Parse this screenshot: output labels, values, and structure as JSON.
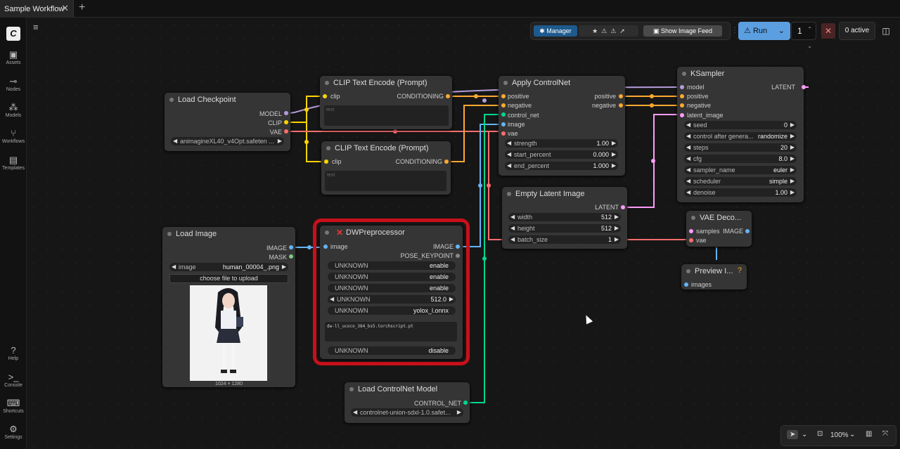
{
  "tab": {
    "title": "Sample Workflow",
    "close": "✕",
    "add": "+"
  },
  "sidebar": [
    {
      "icon": "assets-icon",
      "label": "Assets"
    },
    {
      "icon": "nodes-icon",
      "label": "Nodes"
    },
    {
      "icon": "models-icon",
      "label": "Models"
    },
    {
      "icon": "workflows-icon",
      "label": "Workflows"
    },
    {
      "icon": "templates-icon",
      "label": "Templates"
    },
    {
      "icon": "help-icon",
      "label": "Help"
    },
    {
      "icon": "console-icon",
      "label": "Console"
    },
    {
      "icon": "shortcuts-icon",
      "label": "Shortcuts"
    },
    {
      "icon": "settings-icon",
      "label": "Settings"
    }
  ],
  "toolbar": {
    "manager": "Manager",
    "image_feed": "Show Image Feed",
    "run": "Run",
    "count": "1",
    "active": "0 active"
  },
  "zoom": "100%",
  "nodes": {
    "load_checkpoint": {
      "title": "Load Checkpoint",
      "outputs": [
        "MODEL",
        "CLIP",
        "VAE"
      ],
      "ckpt": "animagineXL40_v4Opt.safeten ..."
    },
    "clip1": {
      "title": "CLIP Text Encode (Prompt)",
      "input": "clip",
      "output": "CONDITIONING",
      "placeholder": "text"
    },
    "clip2": {
      "title": "CLIP Text Encode (Prompt)",
      "input": "clip",
      "output": "CONDITIONING",
      "placeholder": "text"
    },
    "apply_cn": {
      "title": "Apply ControlNet",
      "inputs": [
        "positive",
        "negative",
        "control_net",
        "image",
        "vae"
      ],
      "outputs": [
        "positive",
        "negative"
      ],
      "widgets": [
        {
          "label": "strength",
          "value": "1.00"
        },
        {
          "label": "start_percent",
          "value": "0.000"
        },
        {
          "label": "end_percent",
          "value": "1.000"
        }
      ]
    },
    "ksampler": {
      "title": "KSampler",
      "inputs": [
        "model",
        "positive",
        "negative",
        "latent_image"
      ],
      "output": "LATENT",
      "widgets": [
        {
          "label": "seed",
          "value": "0"
        },
        {
          "label": "control after genera...",
          "value": "randomize"
        },
        {
          "label": "steps",
          "value": "20"
        },
        {
          "label": "cfg",
          "value": "8.0"
        },
        {
          "label": "sampler_name",
          "value": "euler"
        },
        {
          "label": "scheduler",
          "value": "simple"
        },
        {
          "label": "denoise",
          "value": "1.00"
        }
      ]
    },
    "empty_latent": {
      "title": "Empty Latent Image",
      "output": "LATENT",
      "widgets": [
        {
          "label": "width",
          "value": "512"
        },
        {
          "label": "height",
          "value": "512"
        },
        {
          "label": "batch_size",
          "value": "1"
        }
      ]
    },
    "vae_decode": {
      "title": "VAE Deco...",
      "inputs": [
        "samples",
        "vae"
      ],
      "output": "IMAGE"
    },
    "preview": {
      "title": "Preview I...",
      "input": "images",
      "badge": "?"
    },
    "load_image": {
      "title": "Load Image",
      "outputs": [
        "IMAGE",
        "MASK"
      ],
      "image_label": "image",
      "image_value": "human_00004_.png",
      "upload": "choose file to upload",
      "size": "1024 × 1280"
    },
    "dw": {
      "title": "DWPreprocessor",
      "error_mark": "✕",
      "input": "image",
      "outputs": [
        "IMAGE",
        "POSE_KEYPOINT"
      ],
      "widgets": [
        {
          "label": "UNKNOWN",
          "value": "enable"
        },
        {
          "label": "UNKNOWN",
          "value": "enable"
        },
        {
          "label": "UNKNOWN",
          "value": "enable"
        },
        {
          "label": "UNKNOWN",
          "value": "512.0"
        },
        {
          "label": "UNKNOWN",
          "value": "yolox_l.onnx"
        }
      ],
      "text": "dw-ll_ucoco_384_bs5.torchscript.pt",
      "last": {
        "label": "UNKNOWN",
        "value": "disable"
      }
    },
    "load_cn": {
      "title": "Load ControlNet Model",
      "output": "CONTROL_NET",
      "model": "controlnet-union-sdxl-1.0.safet..."
    }
  },
  "colors": {
    "model": "#b39ddb",
    "clip": "#ffd500",
    "vae": "#ff6e6e",
    "conditioning": "#ffa931",
    "image": "#64b5f6",
    "latent": "#ff9cf9",
    "control_net": "#00d78d",
    "mask": "#81c784",
    "highlight": "#c8101a"
  }
}
